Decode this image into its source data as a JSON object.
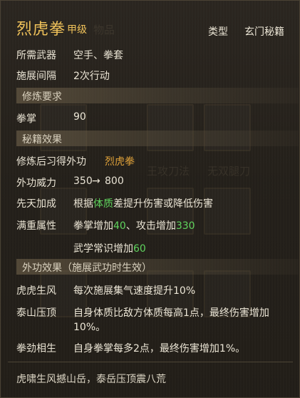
{
  "skill": {
    "name": "烈虎拳",
    "grade": "甲级",
    "type_label": "类型",
    "type_value": "玄门秘籍"
  },
  "requirements_rows": [
    {
      "label": "所需武器",
      "value": "空手、拳套"
    },
    {
      "label": "施展间隔",
      "value": "2次行动"
    }
  ],
  "section_cultivation": "修炼要求",
  "cultivation_rows": [
    {
      "label": "拳掌",
      "value": "90"
    }
  ],
  "section_effects": "秘籍效果",
  "learn": {
    "label": "修炼后习得外功",
    "value": "烈虎拳"
  },
  "power": {
    "label": "外功威力",
    "from": "350",
    "arrow": "→",
    "to": "800"
  },
  "innate": {
    "label": "先天加成",
    "pre": "根据",
    "attr": "体质",
    "post": "差提升伤害或降低伤害"
  },
  "fullweight": {
    "label": "满重属性",
    "line1_a": "拳掌增加",
    "line1_a_val": "40",
    "line1_sep": "、攻击增加",
    "line1_b_val": "330",
    "line2_a": "武学常识增加",
    "line2_a_val": "60"
  },
  "section_external": "外功效果（施展武功时生效）",
  "external_effects": [
    {
      "label": "虎虎生风",
      "text": "每次施展集气速度提升10%"
    },
    {
      "label": "泰山压顶",
      "text": "自身体质比敌方体质每高1点，最终伤害增加",
      "text2": "10%。"
    },
    {
      "label": "拳劲相生",
      "text": "自身拳掌每多2点，最终伤害增加1%。"
    }
  ],
  "footer": "虎啸生风撼山岳，泰岳压顶震八荒",
  "background_ghost_text": [
    "物品",
    "王攻刀法",
    "无双腿刀"
  ]
}
